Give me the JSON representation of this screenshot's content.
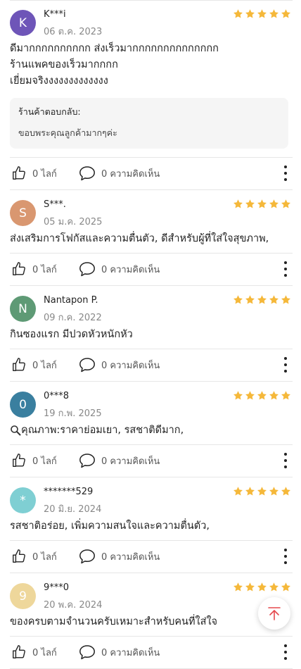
{
  "colors": {
    "star": "#f5b83a",
    "fab_icon": "#e5484d"
  },
  "reviews": [
    {
      "initial": "K",
      "avatar_color": "#6e55b8",
      "name": "K***i",
      "date": "06 ต.ค. 2023",
      "stars": 5,
      "comment_lines": [
        "ดีมากกกกกกกกกก ส่งเร็วมากกกกกกกกกกกกกก",
        "ร้านแพคของเร็วมากกกก",
        "เยี่ยมจริงงงงงงงงงงงงง"
      ],
      "reply": {
        "title": "ร้านค้าตอบกลับ:",
        "text": "ขอบพระคุณลูกค้ามากๆค่ะ"
      },
      "likes": "0 ไลก์",
      "comments": "0 ความคิดเห็น"
    },
    {
      "initial": "S",
      "avatar_color": "#d99770",
      "name": "S***.",
      "date": "05 ม.ค. 2025",
      "stars": 5,
      "comment_lines": [
        "ส่งเสริมการโฟกัสและความตื่นตัว, ดีสำหรับผู้ที่ใส่ใจสุขภาพ,"
      ],
      "likes": "0 ไลก์",
      "comments": "0 ความคิดเห็น"
    },
    {
      "initial": "N",
      "avatar_color": "#5e9a75",
      "name": "Nantapon P.",
      "date": "09 ก.ค. 2022",
      "stars": 5,
      "comment_lines": [
        "กินซองแรก มีปวดหัวหนักหัว"
      ],
      "likes": "0 ไลก์",
      "comments": "0 ความคิดเห็น"
    },
    {
      "initial": "0",
      "avatar_color": "#3a7f9f",
      "name": "0***8",
      "date": "19 ก.พ. 2025",
      "stars": 5,
      "comment_lines": [
        "คุณภาพ:ราคาย่อมเยา, รสชาติดีมาก,"
      ],
      "has_search_icon": true,
      "likes": "0 ไลก์",
      "comments": "0 ความคิดเห็น"
    },
    {
      "initial": "*",
      "avatar_color": "#7fcfd3",
      "name": "*******529",
      "date": "20 มิ.ย. 2024",
      "stars": 5,
      "comment_lines": [
        "รสชาติอร่อย, เพิ่มความสนใจและความตื่นตัว,"
      ],
      "likes": "0 ไลก์",
      "comments": "0 ความคิดเห็น"
    },
    {
      "initial": "9",
      "avatar_color": "#eed79b",
      "name": "9***0",
      "date": "20 พ.ค. 2024",
      "stars": 5,
      "comment_lines": [
        "ของครบตามจำนวนครับเหมาะสำหรับคนที่ใส่ใจ"
      ],
      "likes": "0 ไลก์",
      "comments": "0 ความคิดเห็น"
    }
  ]
}
